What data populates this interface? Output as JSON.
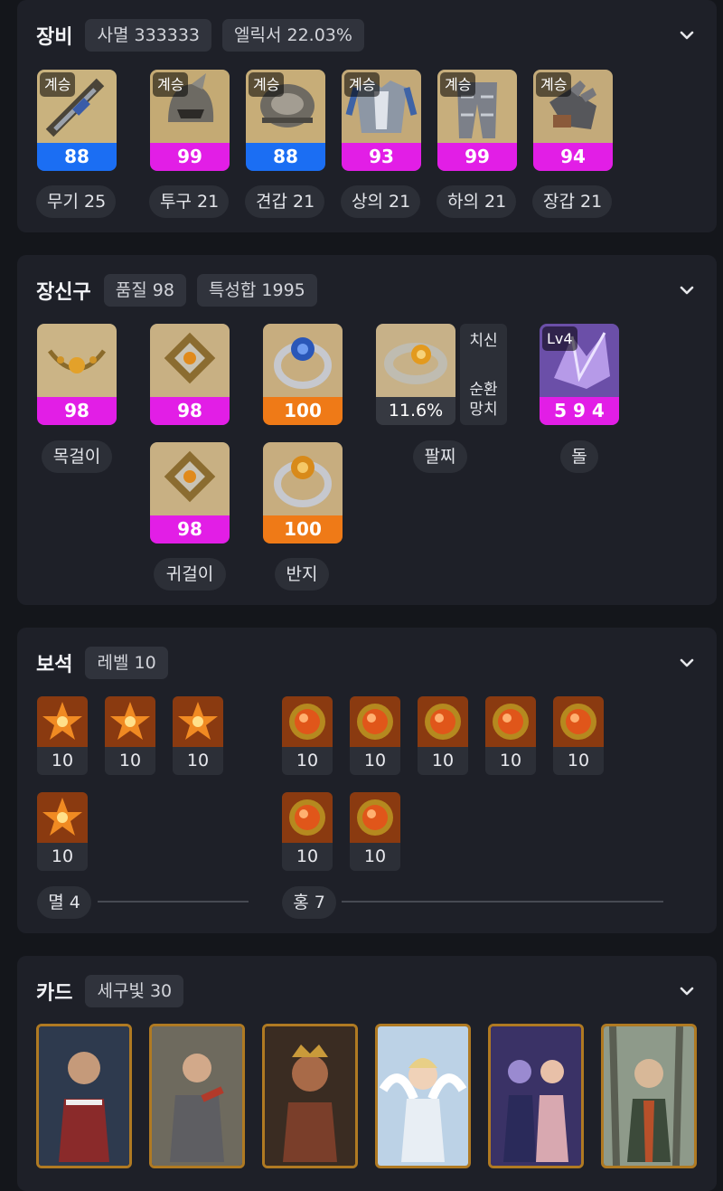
{
  "equipment": {
    "title": "장비",
    "badges": [
      "사멸 333333",
      "엘릭서 22.03%"
    ],
    "items": [
      {
        "tag": "계승",
        "quality": "88",
        "label": "무기 25",
        "bar_color": "#1b6ef3"
      },
      {
        "tag": "계승",
        "quality": "99",
        "label": "투구 21",
        "bar_color": "#e21ee6"
      },
      {
        "tag": "계승",
        "quality": "88",
        "label": "견갑 21",
        "bar_color": "#1b6ef3"
      },
      {
        "tag": "계승",
        "quality": "93",
        "label": "상의 21",
        "bar_color": "#e21ee6"
      },
      {
        "tag": "계승",
        "quality": "99",
        "label": "하의 21",
        "bar_color": "#e21ee6"
      },
      {
        "tag": "계승",
        "quality": "94",
        "label": "장갑 21",
        "bar_color": "#e21ee6"
      }
    ]
  },
  "accessories": {
    "title": "장신구",
    "badges": [
      "품질 98",
      "특성합 1995"
    ],
    "necklace": {
      "quality": "98",
      "label": "목걸이"
    },
    "earring1": {
      "quality": "98"
    },
    "earring2": {
      "quality": "98",
      "label": "귀걸이"
    },
    "ring1": {
      "quality": "100"
    },
    "ring2": {
      "quality": "100",
      "label": "반지"
    },
    "bracelet": {
      "value": "11.6%",
      "label": "팔찌",
      "stats": [
        "치신",
        "순환",
        "망치"
      ]
    },
    "stone": {
      "tag": "Lv4",
      "value": "5 9 4",
      "label": "돌"
    }
  },
  "gems": {
    "title": "보석",
    "badges": [
      "레벨 10"
    ],
    "left_group": {
      "label": "멸 4",
      "levels": [
        "10",
        "10",
        "10",
        "10"
      ]
    },
    "right_group": {
      "label": "홍 7",
      "levels": [
        "10",
        "10",
        "10",
        "10",
        "10",
        "10",
        "10"
      ]
    }
  },
  "cards": {
    "title": "카드",
    "badges": [
      "세구빛 30"
    ],
    "count": 6
  },
  "colors": {
    "bg": "#14161b",
    "panel": "#1e2028",
    "blue_quality": "#1b6ef3",
    "purple_quality": "#e21ee6",
    "orange_quality": "#ef7a17"
  }
}
